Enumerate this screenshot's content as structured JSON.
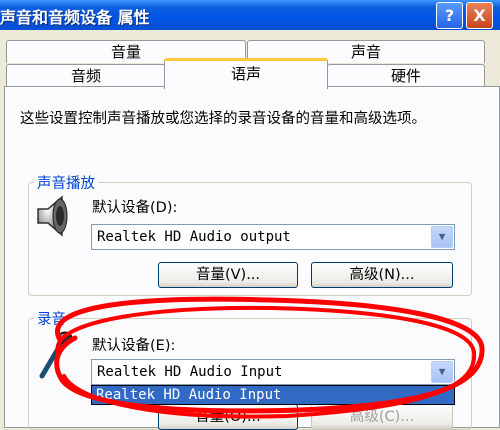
{
  "window": {
    "title": "声音和音频设备 属性",
    "help_button": "?",
    "close_button": "X"
  },
  "tabs": {
    "back_row": [
      "音量",
      "声音"
    ],
    "front_row": [
      "音频",
      "语声",
      "硬件"
    ],
    "active": "语声"
  },
  "description": "这些设置控制声音播放或您选择的录音设备的音量和高级选项。",
  "playback": {
    "group_title": "声音播放",
    "device_label": "默认设备(D):",
    "device_value": "Realtek HD Audio output",
    "volume_button": "音量(V)...",
    "advanced_button": "高级(N)..."
  },
  "recording": {
    "group_title": "录音",
    "device_label": "默认设备(E):",
    "device_value": "Realtek HD Audio Input",
    "dropdown_option": "Realtek HD Audio Input",
    "volume_button": "音量(O)...",
    "advanced_button": "高级(C)..."
  },
  "colors": {
    "annotation_ring": "#ff0000",
    "group_title": "#0046d5",
    "selection": "#316ac5"
  }
}
